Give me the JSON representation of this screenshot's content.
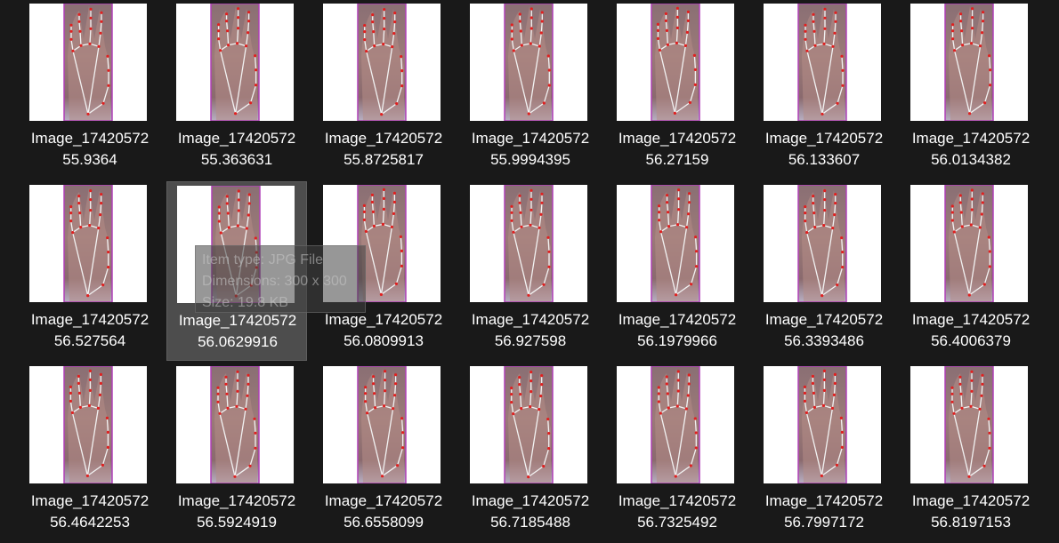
{
  "colors": {
    "background": "#191919",
    "hover_tile": "#4d4d4d",
    "thumb_bg": "#ffffff",
    "photo_strip_border": "#b040b8",
    "landmark_line": "#f2f2f2",
    "landmark_dot": "#e02020"
  },
  "files": [
    {
      "line1": "Image_17420572",
      "line2": "55.9364"
    },
    {
      "line1": "Image_17420572",
      "line2": "55.363631"
    },
    {
      "line1": "Image_17420572",
      "line2": "55.8725817"
    },
    {
      "line1": "Image_17420572",
      "line2": "55.9994395"
    },
    {
      "line1": "Image_17420572",
      "line2": "56.27159"
    },
    {
      "line1": "Image_17420572",
      "line2": "56.133607"
    },
    {
      "line1": "Image_17420572",
      "line2": "56.0134382"
    },
    {
      "line1": "Image_17420572",
      "line2": "56.527564"
    },
    {
      "line1": "Image_17420572",
      "line2": "56.0629916"
    },
    {
      "line1": "Image_17420572",
      "line2": "56.0809913"
    },
    {
      "line1": "Image_17420572",
      "line2": "56.927598"
    },
    {
      "line1": "Image_17420572",
      "line2": "56.1979966"
    },
    {
      "line1": "Image_17420572",
      "line2": "56.3393486"
    },
    {
      "line1": "Image_17420572",
      "line2": "56.4006379"
    },
    {
      "line1": "Image_17420572",
      "line2": "56.4642253"
    },
    {
      "line1": "Image_17420572",
      "line2": "56.5924919"
    },
    {
      "line1": "Image_17420572",
      "line2": "56.6558099"
    },
    {
      "line1": "Image_17420572",
      "line2": "56.7185488"
    },
    {
      "line1": "Image_17420572",
      "line2": "56.7325492"
    },
    {
      "line1": "Image_17420572",
      "line2": "56.7997172"
    },
    {
      "line1": "Image_17420572",
      "line2": "56.8197153"
    }
  ],
  "hovered_index": 8,
  "tooltip": {
    "item_type": "Item type: JPG File",
    "dimensions": "Dimensions: 300 x 300",
    "size": "Size: 19.8 KB"
  }
}
